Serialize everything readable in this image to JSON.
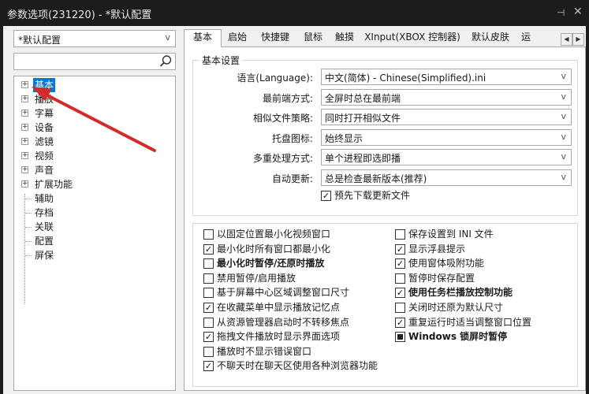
{
  "window": {
    "title": "参数选项(231220) - *默认配置",
    "pin_icon": "pin-icon",
    "close_icon": "close-icon"
  },
  "sidebar": {
    "profile_value": "*默认配置",
    "search_placeholder": "",
    "tree": [
      {
        "label": "基本",
        "expandable": true,
        "selected": true
      },
      {
        "label": "播放",
        "expandable": true
      },
      {
        "label": "字幕",
        "expandable": true
      },
      {
        "label": "设备",
        "expandable": true
      },
      {
        "label": "滤镜",
        "expandable": true
      },
      {
        "label": "视频",
        "expandable": true
      },
      {
        "label": "声音",
        "expandable": true
      },
      {
        "label": "扩展功能",
        "expandable": true
      },
      {
        "label": "辅助",
        "expandable": false
      },
      {
        "label": "存档",
        "expandable": false
      },
      {
        "label": "关联",
        "expandable": false
      },
      {
        "label": "配置",
        "expandable": false
      },
      {
        "label": "屏保",
        "expandable": false
      }
    ]
  },
  "tabs": [
    "基本",
    "启始",
    "快捷键",
    "鼠标",
    "触摸",
    "XInput(XBOX 控制器)",
    "默认皮肤",
    "运"
  ],
  "tab_scroll": {
    "left": "◀",
    "right": "▶"
  },
  "basic": {
    "group_title": "基本设置",
    "rows": [
      {
        "label": "语言(Language):",
        "value": "中文(简体) - Chinese(Simplified).ini"
      },
      {
        "label": "最前端方式:",
        "value": "全屏时总在最前端"
      },
      {
        "label": "相似文件策略:",
        "value": "同时打开相似文件"
      },
      {
        "label": "托盘图标:",
        "value": "始终显示"
      },
      {
        "label": "多重处理方式:",
        "value": "单个进程即选即播"
      },
      {
        "label": "自动更新:",
        "value": "总是检查最新版本(推荐)"
      }
    ],
    "predownload": {
      "label": "预先下载更新文件",
      "state": "checked"
    }
  },
  "options_left": [
    {
      "label": "以固定位置最小化视频窗口",
      "state": "unchecked",
      "bold": false
    },
    {
      "label": "最小化时所有窗口都最小化",
      "state": "checked",
      "bold": false
    },
    {
      "label": "最小化时暂停/还原时播放",
      "state": "unchecked",
      "bold": true
    },
    {
      "label": "禁用暂停/启用播放",
      "state": "unchecked",
      "bold": false
    },
    {
      "label": "基于屏幕中心区域调整窗口尺寸",
      "state": "unchecked",
      "bold": false
    },
    {
      "label": "在收藏菜单中显示播放记忆点",
      "state": "checked",
      "bold": false
    },
    {
      "label": "从资源管理器启动时不转移焦点",
      "state": "unchecked",
      "bold": false
    },
    {
      "label": "拖拽文件播放时显示界面选项",
      "state": "checked",
      "bold": false
    },
    {
      "label": "播放时不显示错误窗口",
      "state": "unchecked",
      "bold": false
    },
    {
      "label": "不聊天时在聊天区使用各种浏览器功能",
      "state": "checked",
      "bold": false
    }
  ],
  "options_right": [
    {
      "label": "保存设置到 INI 文件",
      "state": "unchecked",
      "bold": false
    },
    {
      "label": "显示浮县提示",
      "state": "checked",
      "bold": false
    },
    {
      "label": "使用窗体吸附功能",
      "state": "checked",
      "bold": false
    },
    {
      "label": "暂停时保存配置",
      "state": "unchecked",
      "bold": false
    },
    {
      "label": "使用任务栏播放控制功能",
      "state": "checked",
      "bold": true
    },
    {
      "label": "关闭时还原为默认尺寸",
      "state": "unchecked",
      "bold": false
    },
    {
      "label": "重复运行时适当调整窗口位置",
      "state": "checked",
      "bold": false
    },
    {
      "label": "Windows 锁屏时暂停",
      "state": "indeterminate",
      "bold": true
    }
  ],
  "annotation": {
    "arrow_color": "#d42a2a"
  }
}
